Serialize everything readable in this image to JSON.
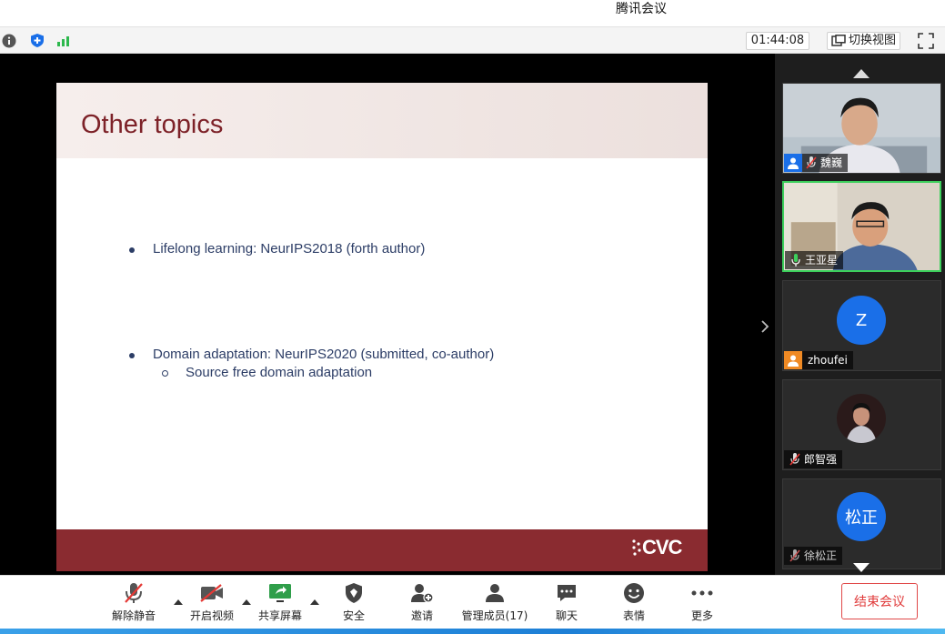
{
  "window": {
    "title": "腾讯会议"
  },
  "infobar": {
    "timer": "01:44:08",
    "switch_view": "切换视图"
  },
  "slide": {
    "title": "Other topics",
    "bullets": [
      {
        "text": "Lifelong learning: NeurIPS2018 (forth author)"
      },
      {
        "text": "Domain adaptation:   NeurIPS2020 (submitted, co-author)",
        "sub": "Source free domain adaptation"
      }
    ],
    "logo": "CVC"
  },
  "participants": [
    {
      "name": "魏巍",
      "type": "video",
      "muted": true
    },
    {
      "name": "王亚星",
      "type": "video",
      "muted": false,
      "speaking": true
    },
    {
      "name": "zhoufei",
      "type": "avatar",
      "initial": "Z"
    },
    {
      "name": "郎智强",
      "type": "photo",
      "muted": true
    },
    {
      "name": "徐松正",
      "type": "avatar",
      "initial": "松正",
      "muted": true
    }
  ],
  "toolbar": {
    "unmute": "解除静音",
    "video": "开启视频",
    "share": "共享屏幕",
    "security": "安全",
    "invite": "邀请",
    "members": "管理成员(17)",
    "chat": "聊天",
    "emoji": "表情",
    "more": "更多",
    "end": "结束会议"
  },
  "colors": {
    "accent": "#1a6fe8",
    "slide_title": "#7d2228",
    "slide_footer": "#8a2b30",
    "end_button": "#e03a3a",
    "active_border": "#3ccf5b"
  }
}
